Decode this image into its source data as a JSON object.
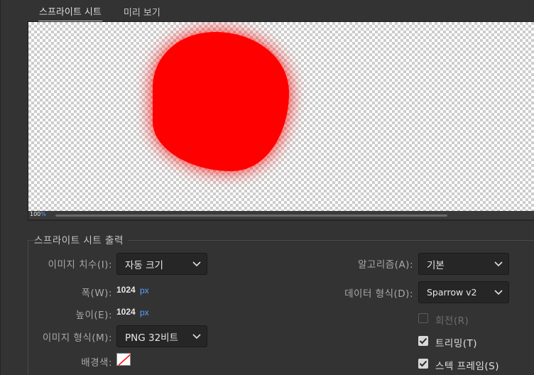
{
  "tabs": [
    {
      "label": "스프라이트 시트",
      "active": true
    },
    {
      "label": "미리 보기",
      "active": false
    }
  ],
  "preview": {
    "zoom_value": "100",
    "zoom_unit": "%",
    "sprite_color": "#ff0000"
  },
  "output": {
    "title": "스프라이트 시트 출력",
    "image_size_label": "이미지 치수(I):",
    "image_size_value": "자동 크기",
    "width_label": "폭(W):",
    "width_value": "1024",
    "height_label": "높이(E):",
    "height_value": "1024",
    "unit": "px",
    "image_format_label": "이미지 형식(M):",
    "image_format_value": "PNG 32비트",
    "background_label": "배경색:",
    "algorithm_label": "알고리즘(A):",
    "algorithm_value": "기본",
    "data_format_label": "데이터 형식(D):",
    "data_format_value": "Sparrow v2",
    "rotate_label": "회전(R)",
    "rotate_checked": false,
    "rotate_enabled": false,
    "trim_label": "트리밍(T)",
    "trim_checked": true,
    "stack_label": "스텍 프레임(S)",
    "stack_checked": true
  },
  "colors": {
    "accent_blue": "#5aa0ff",
    "panel_bg": "#333333",
    "field_bg": "#262626"
  }
}
